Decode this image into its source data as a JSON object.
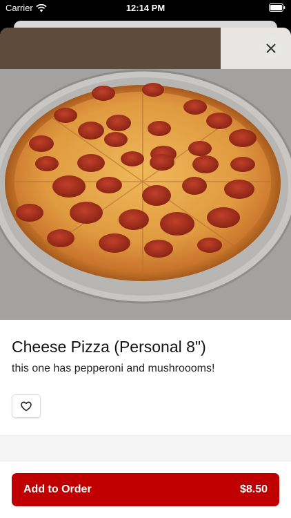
{
  "status_bar": {
    "carrier": "Carrier",
    "time": "12:14 PM",
    "icons": [
      "wifi-icon",
      "battery-icon"
    ]
  },
  "header": {
    "close_icon": "close-icon"
  },
  "item": {
    "image_subject": "pepperoni pizza on metal tray",
    "title": "Cheese Pizza (Personal 8\")",
    "description": "this one has pepperoni and mushroooms!",
    "favorite_icon": "heart-outline-icon"
  },
  "footer": {
    "add_label": "Add to Order",
    "price": "$8.50",
    "accent_color": "#c00000"
  }
}
